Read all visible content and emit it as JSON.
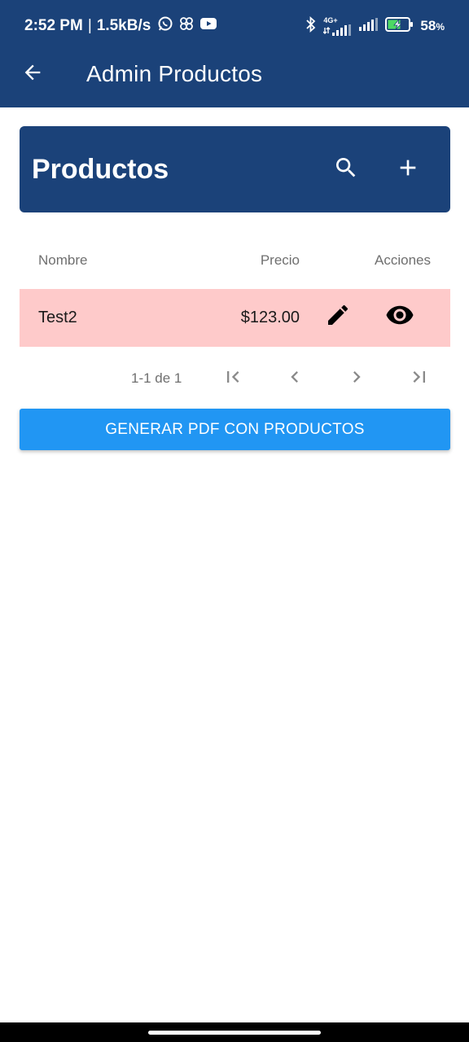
{
  "status_bar": {
    "time": "2:52 PM",
    "separator": "|",
    "net_speed": "1.5kB/s",
    "network_type": "4G+",
    "battery_percent": "58",
    "battery_unit": "%",
    "icons_left": [
      "whatsapp-icon",
      "pinwheel-icon",
      "youtube-icon"
    ],
    "icons_right": [
      "bluetooth-icon",
      "signal-4g-icon",
      "signal-icon",
      "battery-charging-icon"
    ]
  },
  "app_bar": {
    "title": "Admin Productos",
    "back_icon": "arrow-back-icon"
  },
  "products_card": {
    "title": "Productos",
    "search_icon": "search-icon",
    "add_icon": "add-icon"
  },
  "table": {
    "columns": [
      "Nombre",
      "Precio",
      "Acciones"
    ],
    "rows": [
      {
        "name": "Test2",
        "price": "$123.00",
        "actions": [
          "edit-icon",
          "visibility-icon"
        ]
      }
    ]
  },
  "pagination": {
    "info": "1-1 de 1"
  },
  "pdf_button": {
    "label": "GENERAR PDF CON PRODUCTOS"
  },
  "colors": {
    "primary_dark": "#1b4279",
    "accent": "#2196f3",
    "row_highlight": "#fecaca"
  }
}
